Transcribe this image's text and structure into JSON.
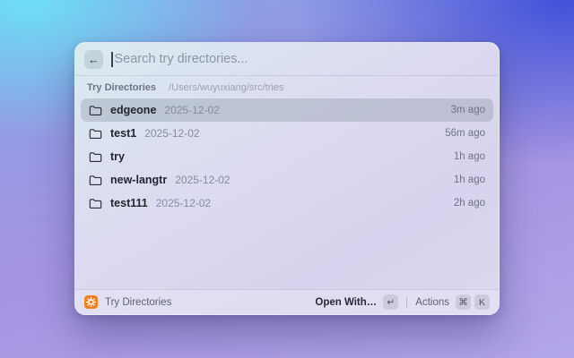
{
  "search": {
    "placeholder": "Search try directories...",
    "back_icon": "←"
  },
  "section": {
    "label": "Try Directories",
    "path": "/Users/wuyuxiang/src/tries"
  },
  "list": [
    {
      "name": "edgeone",
      "date": "2025-12-02",
      "time": "3m ago",
      "selected": true
    },
    {
      "name": "test1",
      "date": "2025-12-02",
      "time": "56m ago",
      "selected": false
    },
    {
      "name": "try",
      "date": "",
      "time": "1h ago",
      "selected": false
    },
    {
      "name": "new-langtr",
      "date": "2025-12-02",
      "time": "1h ago",
      "selected": false
    },
    {
      "name": "test111",
      "date": "2025-12-02",
      "time": "2h ago",
      "selected": false
    }
  ],
  "footer": {
    "app_label": "Try Directories",
    "primary_action": "Open With…",
    "primary_key": "↵",
    "secondary_action": "Actions",
    "secondary_keys": [
      "⌘",
      "K"
    ]
  },
  "colors": {
    "accent_orange": "#f4801d",
    "bg_top_left": "#6ce2f6",
    "bg_top_right": "#3e4dd8",
    "bg_bottom": "#b3a5e8",
    "window_tint": "#dad7ef",
    "selection": "rgba(112,126,138,0.27)"
  }
}
